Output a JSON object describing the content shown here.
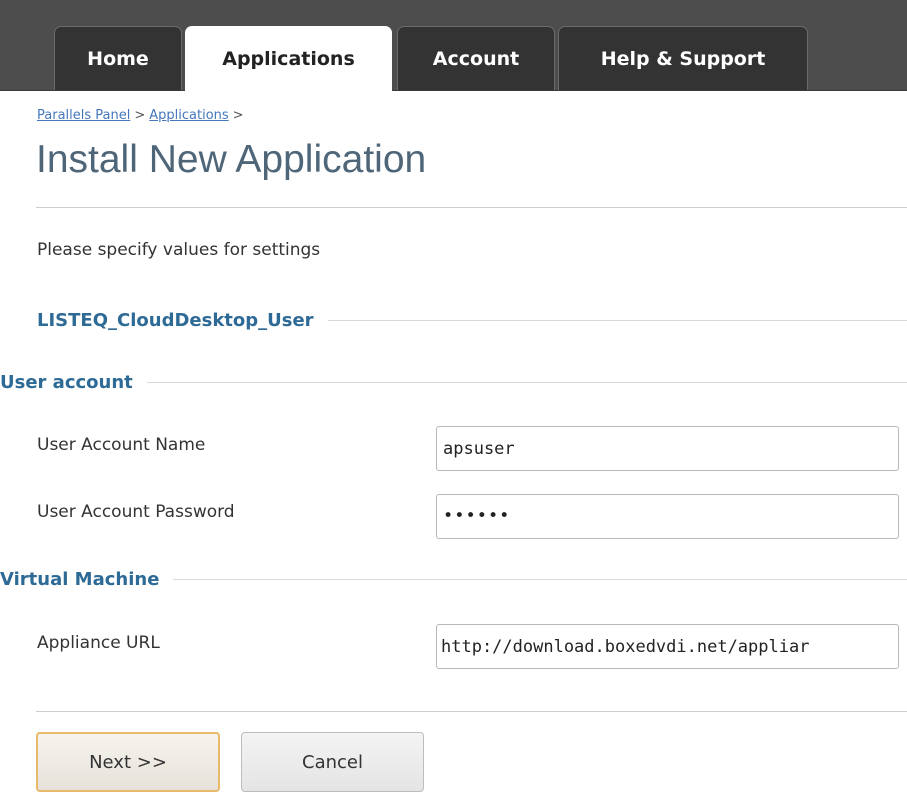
{
  "tabs": [
    {
      "label": "Home",
      "active": false
    },
    {
      "label": "Applications",
      "active": true
    },
    {
      "label": "Account",
      "active": false
    },
    {
      "label": "Help & Support",
      "active": false
    }
  ],
  "breadcrumb": {
    "items": [
      "Parallels Panel",
      "Applications"
    ],
    "separator": ">"
  },
  "page": {
    "title": "Install New Application",
    "intro": "Please specify values for settings"
  },
  "form": {
    "app_section": "LISTEQ_CloudDesktop_User",
    "user_section": {
      "heading": "User account",
      "name_label": "User Account Name",
      "name_value": "apsuser",
      "password_label": "User Account Password",
      "password_value": "••••••"
    },
    "vm_section": {
      "heading": "Virtual Machine",
      "url_label": "Appliance URL",
      "url_value": "http://download.boxedvdi.net/appliar"
    }
  },
  "buttons": {
    "next_label": "Next >>",
    "cancel_label": "Cancel"
  },
  "colors": {
    "tabbar_bg": "#4d4d4d",
    "tab_bg": "#333333",
    "title": "#4e6678",
    "section_heading": "#2e6a96",
    "link": "#4477bb",
    "next_button_border": "#e6b96b"
  }
}
